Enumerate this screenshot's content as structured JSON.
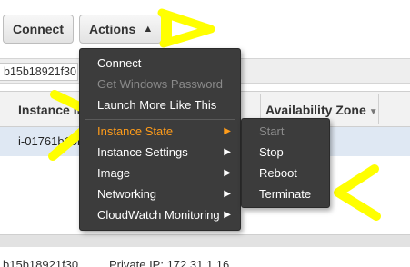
{
  "toolbar": {
    "connect_label": "Connect",
    "actions_label": "Actions",
    "actions_caret": "^"
  },
  "filter": {
    "value": "b15b18921f30"
  },
  "table": {
    "headers": {
      "instance_id": "Instance ID",
      "availability_zone": "Availability Zone"
    },
    "rows": [
      {
        "instance_id": "i-01761b15b"
      }
    ]
  },
  "details": {
    "id_text": "b15b18921f30",
    "private_ip": "Private IP: 172.31.1.16"
  },
  "actions_menu": {
    "items": [
      {
        "label": "Connect",
        "state": "normal"
      },
      {
        "label": "Get Windows Password",
        "state": "disabled"
      },
      {
        "label": "Launch More Like This",
        "state": "normal"
      },
      {
        "label": "Instance State",
        "state": "active",
        "submenu": true
      },
      {
        "label": "Instance Settings",
        "state": "normal",
        "submenu": true
      },
      {
        "label": "Image",
        "state": "normal",
        "submenu": true
      },
      {
        "label": "Networking",
        "state": "normal",
        "submenu": true
      },
      {
        "label": "CloudWatch Monitoring",
        "state": "normal",
        "submenu": true
      }
    ]
  },
  "instance_state_submenu": {
    "items": [
      {
        "label": "Start",
        "state": "disabled"
      },
      {
        "label": "Stop",
        "state": "normal"
      },
      {
        "label": "Reboot",
        "state": "normal"
      },
      {
        "label": "Terminate",
        "state": "normal"
      }
    ]
  },
  "colors": {
    "menu_bg": "#3c3c3c",
    "active_item": "#ff9c1a",
    "disabled_item": "#8a8a8a",
    "highlight_annotation": "#ffff00",
    "selected_row": "#dfe8f3"
  },
  "icons": {
    "submenu_arrow": "chevron-right-icon",
    "sort_arrow": "sort-down-icon",
    "actions_caret": "chevron-up-icon"
  }
}
